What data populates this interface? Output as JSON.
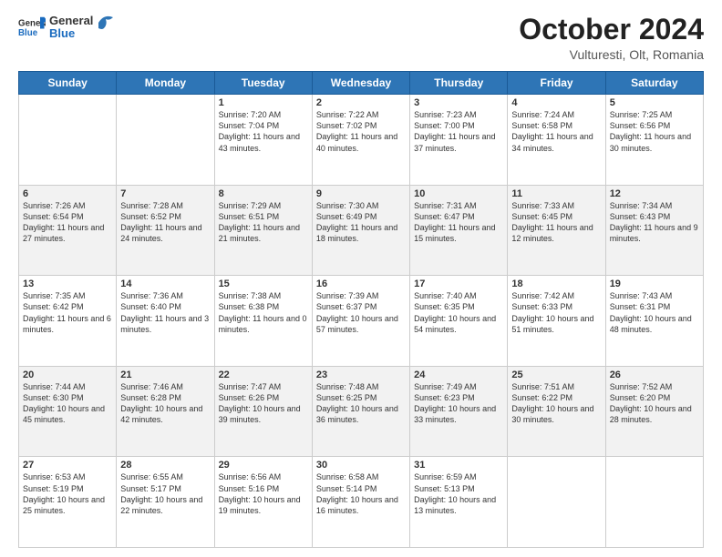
{
  "header": {
    "logo_general": "General",
    "logo_blue": "Blue",
    "month_title": "October 2024",
    "location": "Vulturesti, Olt, Romania"
  },
  "days_of_week": [
    "Sunday",
    "Monday",
    "Tuesday",
    "Wednesday",
    "Thursday",
    "Friday",
    "Saturday"
  ],
  "weeks": [
    [
      {
        "day": "",
        "sunrise": "",
        "sunset": "",
        "daylight": ""
      },
      {
        "day": "",
        "sunrise": "",
        "sunset": "",
        "daylight": ""
      },
      {
        "day": "1",
        "sunrise": "Sunrise: 7:20 AM",
        "sunset": "Sunset: 7:04 PM",
        "daylight": "Daylight: 11 hours and 43 minutes."
      },
      {
        "day": "2",
        "sunrise": "Sunrise: 7:22 AM",
        "sunset": "Sunset: 7:02 PM",
        "daylight": "Daylight: 11 hours and 40 minutes."
      },
      {
        "day": "3",
        "sunrise": "Sunrise: 7:23 AM",
        "sunset": "Sunset: 7:00 PM",
        "daylight": "Daylight: 11 hours and 37 minutes."
      },
      {
        "day": "4",
        "sunrise": "Sunrise: 7:24 AM",
        "sunset": "Sunset: 6:58 PM",
        "daylight": "Daylight: 11 hours and 34 minutes."
      },
      {
        "day": "5",
        "sunrise": "Sunrise: 7:25 AM",
        "sunset": "Sunset: 6:56 PM",
        "daylight": "Daylight: 11 hours and 30 minutes."
      }
    ],
    [
      {
        "day": "6",
        "sunrise": "Sunrise: 7:26 AM",
        "sunset": "Sunset: 6:54 PM",
        "daylight": "Daylight: 11 hours and 27 minutes."
      },
      {
        "day": "7",
        "sunrise": "Sunrise: 7:28 AM",
        "sunset": "Sunset: 6:52 PM",
        "daylight": "Daylight: 11 hours and 24 minutes."
      },
      {
        "day": "8",
        "sunrise": "Sunrise: 7:29 AM",
        "sunset": "Sunset: 6:51 PM",
        "daylight": "Daylight: 11 hours and 21 minutes."
      },
      {
        "day": "9",
        "sunrise": "Sunrise: 7:30 AM",
        "sunset": "Sunset: 6:49 PM",
        "daylight": "Daylight: 11 hours and 18 minutes."
      },
      {
        "day": "10",
        "sunrise": "Sunrise: 7:31 AM",
        "sunset": "Sunset: 6:47 PM",
        "daylight": "Daylight: 11 hours and 15 minutes."
      },
      {
        "day": "11",
        "sunrise": "Sunrise: 7:33 AM",
        "sunset": "Sunset: 6:45 PM",
        "daylight": "Daylight: 11 hours and 12 minutes."
      },
      {
        "day": "12",
        "sunrise": "Sunrise: 7:34 AM",
        "sunset": "Sunset: 6:43 PM",
        "daylight": "Daylight: 11 hours and 9 minutes."
      }
    ],
    [
      {
        "day": "13",
        "sunrise": "Sunrise: 7:35 AM",
        "sunset": "Sunset: 6:42 PM",
        "daylight": "Daylight: 11 hours and 6 minutes."
      },
      {
        "day": "14",
        "sunrise": "Sunrise: 7:36 AM",
        "sunset": "Sunset: 6:40 PM",
        "daylight": "Daylight: 11 hours and 3 minutes."
      },
      {
        "day": "15",
        "sunrise": "Sunrise: 7:38 AM",
        "sunset": "Sunset: 6:38 PM",
        "daylight": "Daylight: 11 hours and 0 minutes."
      },
      {
        "day": "16",
        "sunrise": "Sunrise: 7:39 AM",
        "sunset": "Sunset: 6:37 PM",
        "daylight": "Daylight: 10 hours and 57 minutes."
      },
      {
        "day": "17",
        "sunrise": "Sunrise: 7:40 AM",
        "sunset": "Sunset: 6:35 PM",
        "daylight": "Daylight: 10 hours and 54 minutes."
      },
      {
        "day": "18",
        "sunrise": "Sunrise: 7:42 AM",
        "sunset": "Sunset: 6:33 PM",
        "daylight": "Daylight: 10 hours and 51 minutes."
      },
      {
        "day": "19",
        "sunrise": "Sunrise: 7:43 AM",
        "sunset": "Sunset: 6:31 PM",
        "daylight": "Daylight: 10 hours and 48 minutes."
      }
    ],
    [
      {
        "day": "20",
        "sunrise": "Sunrise: 7:44 AM",
        "sunset": "Sunset: 6:30 PM",
        "daylight": "Daylight: 10 hours and 45 minutes."
      },
      {
        "day": "21",
        "sunrise": "Sunrise: 7:46 AM",
        "sunset": "Sunset: 6:28 PM",
        "daylight": "Daylight: 10 hours and 42 minutes."
      },
      {
        "day": "22",
        "sunrise": "Sunrise: 7:47 AM",
        "sunset": "Sunset: 6:26 PM",
        "daylight": "Daylight: 10 hours and 39 minutes."
      },
      {
        "day": "23",
        "sunrise": "Sunrise: 7:48 AM",
        "sunset": "Sunset: 6:25 PM",
        "daylight": "Daylight: 10 hours and 36 minutes."
      },
      {
        "day": "24",
        "sunrise": "Sunrise: 7:49 AM",
        "sunset": "Sunset: 6:23 PM",
        "daylight": "Daylight: 10 hours and 33 minutes."
      },
      {
        "day": "25",
        "sunrise": "Sunrise: 7:51 AM",
        "sunset": "Sunset: 6:22 PM",
        "daylight": "Daylight: 10 hours and 30 minutes."
      },
      {
        "day": "26",
        "sunrise": "Sunrise: 7:52 AM",
        "sunset": "Sunset: 6:20 PM",
        "daylight": "Daylight: 10 hours and 28 minutes."
      }
    ],
    [
      {
        "day": "27",
        "sunrise": "Sunrise: 6:53 AM",
        "sunset": "Sunset: 5:19 PM",
        "daylight": "Daylight: 10 hours and 25 minutes."
      },
      {
        "day": "28",
        "sunrise": "Sunrise: 6:55 AM",
        "sunset": "Sunset: 5:17 PM",
        "daylight": "Daylight: 10 hours and 22 minutes."
      },
      {
        "day": "29",
        "sunrise": "Sunrise: 6:56 AM",
        "sunset": "Sunset: 5:16 PM",
        "daylight": "Daylight: 10 hours and 19 minutes."
      },
      {
        "day": "30",
        "sunrise": "Sunrise: 6:58 AM",
        "sunset": "Sunset: 5:14 PM",
        "daylight": "Daylight: 10 hours and 16 minutes."
      },
      {
        "day": "31",
        "sunrise": "Sunrise: 6:59 AM",
        "sunset": "Sunset: 5:13 PM",
        "daylight": "Daylight: 10 hours and 13 minutes."
      },
      {
        "day": "",
        "sunrise": "",
        "sunset": "",
        "daylight": ""
      },
      {
        "day": "",
        "sunrise": "",
        "sunset": "",
        "daylight": ""
      }
    ]
  ]
}
